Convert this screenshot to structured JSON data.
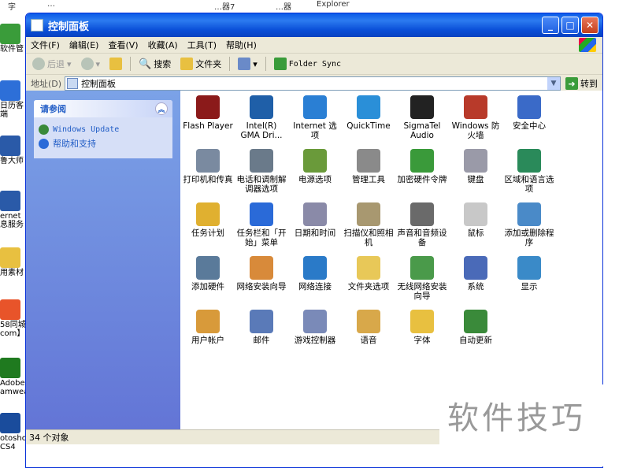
{
  "desktop": {
    "top_strip": [
      "字",
      "…",
      "…器7",
      "…器",
      "Explorer"
    ],
    "icons": [
      {
        "label": "软件管",
        "color": "#3a9c3a"
      },
      {
        "label": "日历客端",
        "color": "#2d6fd8"
      },
      {
        "label": "鲁大师",
        "color": "#2a5aa8"
      },
      {
        "label": "ernet 息服务",
        "color": "#2a5aa8"
      },
      {
        "label": "用素材",
        "color": "#e8c040"
      },
      {
        "label": "58同城 com】",
        "color": "#e8542a"
      },
      {
        "label": "Adobe amwea.",
        "color": "#1f7a1f"
      },
      {
        "label": "otosho CS4",
        "color": "#1a4c9c"
      }
    ]
  },
  "window": {
    "title": "控制面板",
    "menu": [
      "文件(F)",
      "编辑(E)",
      "查看(V)",
      "收藏(A)",
      "工具(T)",
      "帮助(H)"
    ],
    "toolbar": {
      "back": "后退",
      "search": "搜索",
      "folders": "文件夹",
      "folder_sync": "Folder Sync"
    },
    "address": {
      "label": "地址(D)",
      "value": "控制面板",
      "go": "转到"
    },
    "see_also": {
      "title": "请参阅",
      "links": [
        "Windows Update",
        "帮助和支持"
      ]
    },
    "items": [
      {
        "label": "Flash Player",
        "icon": "flash-icon",
        "color": "#8b1a1a"
      },
      {
        "label": "Intel(R) GMA Dri...",
        "icon": "intel-icon",
        "color": "#1f5fa8"
      },
      {
        "label": "Internet 选项",
        "icon": "internet-options-icon",
        "color": "#2a7fd4"
      },
      {
        "label": "QuickTime",
        "icon": "quicktime-icon",
        "color": "#2a8fd8"
      },
      {
        "label": "SigmaTel Audio",
        "icon": "sigmatel-icon",
        "color": "#222222"
      },
      {
        "label": "Windows 防火墙",
        "icon": "firewall-icon",
        "color": "#b83a2a"
      },
      {
        "label": "安全中心",
        "icon": "security-center-icon",
        "color": "#3a6ac8"
      },
      {
        "label": "打印机和传真",
        "icon": "printer-icon",
        "color": "#7a8aa0"
      },
      {
        "label": "电话和调制解调器选项",
        "icon": "phone-modem-icon",
        "color": "#6a7a8a"
      },
      {
        "label": "电源选项",
        "icon": "power-options-icon",
        "color": "#6a9a3a"
      },
      {
        "label": "管理工具",
        "icon": "admin-tools-icon",
        "color": "#8a8a8a"
      },
      {
        "label": "加密硬件令牌",
        "icon": "token-icon",
        "color": "#3a9a3a"
      },
      {
        "label": "键盘",
        "icon": "keyboard-icon",
        "color": "#9a9aa8"
      },
      {
        "label": "区域和语言选项",
        "icon": "globe-icon",
        "color": "#2a8a5a"
      },
      {
        "label": "任务计划",
        "icon": "task-scheduler-icon",
        "color": "#e0b030"
      },
      {
        "label": "任务栏和「开始」菜单",
        "icon": "taskbar-icon",
        "color": "#2a6ad8"
      },
      {
        "label": "日期和时间",
        "icon": "clock-icon",
        "color": "#8a8aa8"
      },
      {
        "label": "扫描仪和照相机",
        "icon": "scanner-icon",
        "color": "#a89870"
      },
      {
        "label": "声音和音频设备",
        "icon": "speaker-icon",
        "color": "#6a6a6a"
      },
      {
        "label": "鼠标",
        "icon": "mouse-icon",
        "color": "#c8c8c8"
      },
      {
        "label": "添加或删除程序",
        "icon": "add-remove-programs-icon",
        "color": "#4a8ac8"
      },
      {
        "label": "添加硬件",
        "icon": "add-hardware-icon",
        "color": "#5a7a9a"
      },
      {
        "label": "网络安装向导",
        "icon": "network-setup-icon",
        "color": "#d88a3a"
      },
      {
        "label": "网络连接",
        "icon": "network-connections-icon",
        "color": "#2a7ac8"
      },
      {
        "label": "文件夹选项",
        "icon": "folder-options-icon",
        "color": "#e8c858"
      },
      {
        "label": "无线网络安装向导",
        "icon": "wireless-icon",
        "color": "#4a9a4a"
      },
      {
        "label": "系统",
        "icon": "system-icon",
        "color": "#4a6ab8"
      },
      {
        "label": "显示",
        "icon": "display-icon",
        "color": "#3a8ac8"
      },
      {
        "label": "用户帐户",
        "icon": "user-accounts-icon",
        "color": "#d89a3a"
      },
      {
        "label": "邮件",
        "icon": "mail-icon",
        "color": "#5a7ab8"
      },
      {
        "label": "游戏控制器",
        "icon": "game-controller-icon",
        "color": "#7a8ab8"
      },
      {
        "label": "语音",
        "icon": "speech-icon",
        "color": "#d8a84a"
      },
      {
        "label": "字体",
        "icon": "fonts-icon",
        "color": "#e8c040"
      },
      {
        "label": "自动更新",
        "icon": "windows-update-icon",
        "color": "#3a8a3a"
      }
    ],
    "status": "34 个对象"
  },
  "watermark": "软件技巧"
}
